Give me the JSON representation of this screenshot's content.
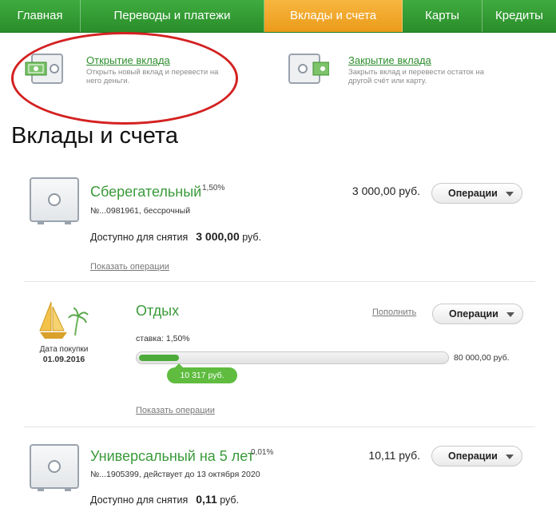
{
  "nav": {
    "items": [
      "Главная",
      "Переводы и платежи",
      "Вклады и счета",
      "Карты",
      "Кредиты"
    ],
    "active_index": 2
  },
  "quick_actions": {
    "open": {
      "title": "Открытие вклада",
      "desc": "Открыть новый вклад и перевести на него деньги."
    },
    "close": {
      "title": "Закрытие вклада",
      "desc": "Закрыть вклад и перевести остаток на другой счёт или карту."
    }
  },
  "page_title": "Вклады и счета",
  "accounts": [
    {
      "name": "Сберегательный",
      "rate": "1,50%",
      "number": "№...0981961, бессрочный",
      "available_label": "Доступно для снятия",
      "available_value": "3 000,00",
      "currency": "руб.",
      "amount": "3 000,00 руб.",
      "operations_label": "Операции",
      "show_ops": "Показать операции"
    },
    {
      "name": "Отдых",
      "purchase_label": "Дата покупки",
      "purchase_date": "01.09.2016",
      "topup_label": "Пополнить",
      "operations_label": "Операции",
      "rate_label": "ставка: 1,50%",
      "goal_amount": "80 000,00 руб.",
      "current_amount": "10 317 руб.",
      "progress_fraction": 0.129,
      "show_ops": "Показать операции"
    },
    {
      "name": "Универсальный на 5 лет",
      "rate": "0,01%",
      "number": "№...1905399, действует до 13 октября 2020",
      "available_label": "Доступно для снятия",
      "available_value": "0,11",
      "currency": "руб.",
      "amount": "10,11 руб.",
      "operations_label": "Операции"
    }
  ],
  "colors": {
    "nav_green": "#2f9a2f",
    "nav_active": "#f0a52a",
    "link_green": "#3a9a3a",
    "highlight_red": "#d42121",
    "progress_green": "#4dab3a"
  }
}
